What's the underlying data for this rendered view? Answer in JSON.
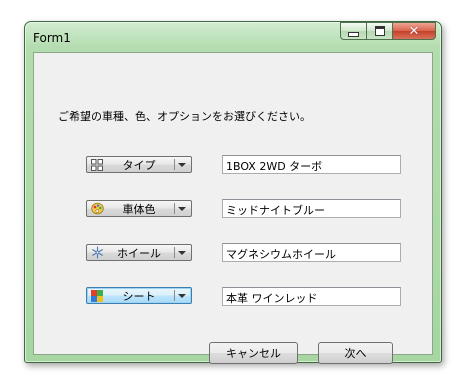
{
  "window": {
    "title": "Form1",
    "close_glyph": "✕"
  },
  "prompt": "ご希望の車種、色、オプションをお選びください。",
  "options": [
    {
      "label": "タイプ",
      "icon": "grid-icon",
      "value": "1BOX 2WD ターボ"
    },
    {
      "label": "車体色",
      "icon": "palette-icon",
      "value": "ミッドナイトブルー"
    },
    {
      "label": "ホイール",
      "icon": "snowflake-icon",
      "value": "マグネシウムホイール"
    },
    {
      "label": "シート",
      "icon": "colored-tiles-icon",
      "value": "本革 ワインレッド"
    }
  ],
  "buttons": {
    "cancel": "キャンセル",
    "next": "次へ"
  }
}
